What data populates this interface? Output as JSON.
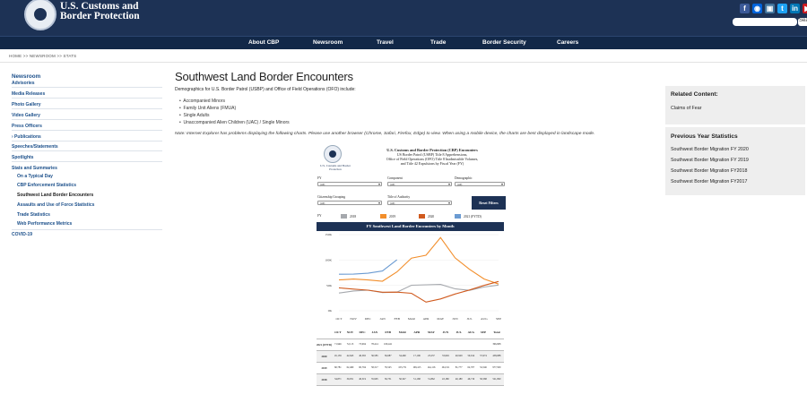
{
  "agency": {
    "line1": "U.S. Customs and",
    "line2": "Border Protection"
  },
  "social": [
    {
      "icon": "facebook-icon",
      "glyph": "f",
      "color": "#3b5998"
    },
    {
      "icon": "flickr-icon",
      "glyph": "◉",
      "color": "#0063dc"
    },
    {
      "icon": "instagram-icon",
      "glyph": "▣",
      "color": "#3f729b"
    },
    {
      "icon": "twitter-icon",
      "glyph": "t",
      "color": "#1da1f2"
    },
    {
      "icon": "linkedin-icon",
      "glyph": "in",
      "color": "#0077b5"
    },
    {
      "icon": "youtube-icon",
      "glyph": "▶",
      "color": "#cc181e"
    }
  ],
  "search": {
    "button": "Sea"
  },
  "nav": [
    "About CBP",
    "Newsroom",
    "Travel",
    "Trade",
    "Border Security",
    "Careers"
  ],
  "breadcrumb": "HOME  >>  NEWSROOM  >>  STATS",
  "sidebar": {
    "section": "Newsroom",
    "items": [
      {
        "label": "Advisories"
      },
      {
        "label": "Media Releases"
      },
      {
        "label": "Photo Gallery"
      },
      {
        "label": "Video Gallery"
      },
      {
        "label": "Press Officers"
      },
      {
        "label": "› Publications"
      },
      {
        "label": "Speeches/Statements"
      },
      {
        "label": "Spotlights"
      },
      {
        "label": "Stats and Summaries"
      },
      {
        "label": "On a Typical Day"
      },
      {
        "label": "CBP Enforcement Statistics"
      },
      {
        "label": "Southwest Land Border Encounters"
      },
      {
        "label": "Assaults and Use of Force Statistics"
      },
      {
        "label": "Trade Statistics"
      },
      {
        "label": "Web Performance Metrics"
      },
      {
        "label": "COVID-19"
      }
    ]
  },
  "main": {
    "title": "Southwest Land Border Encounters",
    "intro": "Demographics for U.S. Border Patrol (USBP) and Office of Field Operations (OFO) include:",
    "bullets": [
      "Accompanied Minors",
      "Family Unit Aliens (FMUA)",
      "Single Adults",
      "Unaccompanied Alien Children (UAC) / Single Minors"
    ],
    "note": "Note: Internet Explorer has problems displaying the following charts. Please use another browser (Chrome, Safari, Firefox, Edge) to view. When using a mobile device, the charts are best displayed in landscape mode."
  },
  "dashboard": {
    "agency": "U.S. Customs and Border Protection",
    "title_lines": [
      "U.S. Customs and Border Protection (CBP) Encounters",
      "US Border Patrol (USBP) Title 8 Apprehensions,",
      "Office of Field Operations (OFO) Title 8 Inadmissible Volumes,",
      "and Title 42 Expulsions by Fiscal Year (FY)"
    ],
    "filters": {
      "fy_label": "FY",
      "fy_value": "(All)",
      "component_label": "Component",
      "component_value": "(All)",
      "demographic_label": "Demographic",
      "demographic_value": "(All)",
      "citizenship_label": "Citizenship Grouping",
      "citizenship_value": "(All)",
      "authority_label": "Title of Authority",
      "authority_value": "(All)",
      "reset": "Reset Filters"
    },
    "legend_label": "FY",
    "chart_title": "FY Southwest Land Border Encounters by Month"
  },
  "chart_data": {
    "type": "line",
    "title": "FY Southwest Land Border Encounters by Month",
    "categories": [
      "OCT",
      "NOV",
      "DEC",
      "JAN",
      "FEB",
      "MAR",
      "APR",
      "MAY",
      "JUN",
      "JUL",
      "AUG",
      "SEP"
    ],
    "y_ticks": [
      "0K",
      "50K",
      "100K",
      "150K"
    ],
    "ylim": [
      0,
      150000
    ],
    "series": [
      {
        "name": "2018",
        "color": "#a5a8ad",
        "values": [
          34871,
          39051,
          40519,
          35905,
          36751,
          50347,
          51168,
          51862,
          43180,
          40180,
          46719,
          50568
        ]
      },
      {
        "name": "2019",
        "color": "#f28e2b",
        "values": [
          60781,
          62469,
          60794,
          58317,
          76545,
          103731,
          109415,
          144116,
          104311,
          81777,
          62707,
          52546
        ]
      },
      {
        "name": "2020",
        "color": "#d05a1e",
        "values": [
          45139,
          42643,
          40565,
          36585,
          36687,
          34460,
          17106,
          23237,
          33049,
          40929,
          50014,
          57674
        ]
      },
      {
        "name": "2021 (FYTD)",
        "color": "#6b9bd2",
        "values": [
          71946,
          72113,
          73994,
          78414,
          100441,
          null,
          null,
          null,
          null,
          null,
          null,
          null
        ]
      }
    ],
    "table": {
      "header": [
        "OCT",
        "NOV",
        "DEC",
        "JAN",
        "FEB",
        "MAR",
        "APR",
        "MAY",
        "JUN",
        "JUL",
        "AUG",
        "SEP",
        "Total"
      ],
      "rows": [
        {
          "label": "2021 (FYTD)",
          "cells": [
            "71,946",
            "72,113",
            "73,994",
            "78,414",
            "100,441",
            "",
            "",
            "",
            "",
            "",
            "",
            "",
            "396,908"
          ]
        },
        {
          "label": "2020",
          "cells": [
            "45,139",
            "42,643",
            "40,565",
            "36,585",
            "36,687",
            "34,460",
            "17,106",
            "23,237",
            "33,049",
            "40,929",
            "50,014",
            "57,674",
            "458,088"
          ]
        },
        {
          "label": "2019",
          "cells": [
            "60,781",
            "62,469",
            "60,794",
            "58,317",
            "76,545",
            "103,731",
            "109,415",
            "144,116",
            "104,311",
            "81,777",
            "62,707",
            "52,546",
            "977,509"
          ]
        },
        {
          "label": "2018",
          "cells": [
            "34,871",
            "39,051",
            "40,519",
            "35,905",
            "36,751",
            "50,347",
            "51,168",
            "51,862",
            "43,180",
            "40,180",
            "46,719",
            "50,568",
            "521,090"
          ]
        }
      ]
    }
  },
  "related": {
    "heading": "Related Content:",
    "items": [
      "Claims of Fear"
    ]
  },
  "previous": {
    "heading": "Previous Year Statistics",
    "items": [
      "Southwest Border Migration FY 2020",
      "Southwest Border Migration FY 2019",
      "Southwest Border Migration FY2018",
      "Southwest Border Migration FY2017"
    ]
  }
}
